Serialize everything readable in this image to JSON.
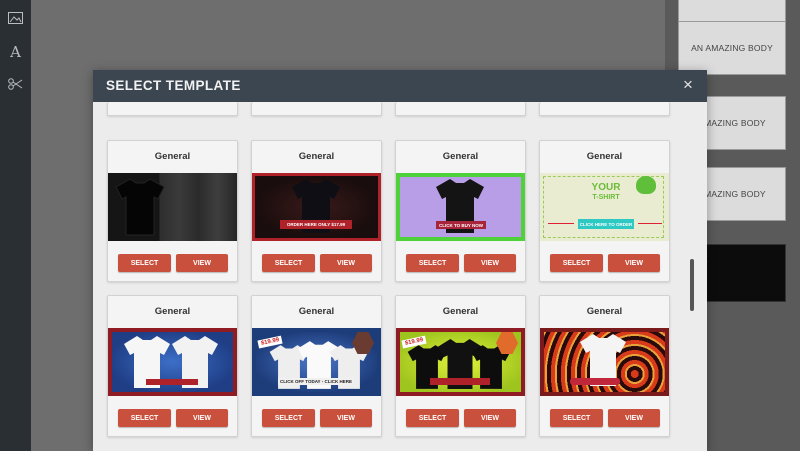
{
  "toolbar": {
    "items": [
      {
        "name": "image-icon"
      },
      {
        "name": "text-icon",
        "glyph": "A"
      },
      {
        "name": "scissors-icon"
      }
    ]
  },
  "side_panel": {
    "buttons": [
      "AN AMAZING BODY",
      "AMAZING BODY",
      "AMAZING BODY"
    ]
  },
  "modal": {
    "title": "SELECT TEMPLATE",
    "close_label": "×",
    "templates": [
      {
        "title": "General",
        "select_label": "SELECT",
        "view_label": "VIEW"
      },
      {
        "title": "General",
        "select_label": "SELECT",
        "view_label": "VIEW",
        "banner": "ORDER HERE ONLY $17.99"
      },
      {
        "title": "General",
        "select_label": "SELECT",
        "view_label": "VIEW",
        "banner": "CLICK TO BUY NOW"
      },
      {
        "title": "General",
        "select_label": "SELECT",
        "view_label": "VIEW",
        "headline_1": "YOUR",
        "headline_2": "T-SHIRT",
        "banner": "CLICK HERE TO ORDER"
      },
      {
        "title": "General",
        "select_label": "SELECT",
        "view_label": "VIEW"
      },
      {
        "title": "General",
        "select_label": "SELECT",
        "view_label": "VIEW",
        "price": "$19.99",
        "banner": "CLICK OFF TODAY - CLICK HERE"
      },
      {
        "title": "General",
        "select_label": "SELECT",
        "view_label": "VIEW",
        "price": "$19.99"
      },
      {
        "title": "General",
        "select_label": "SELECT",
        "view_label": "VIEW"
      }
    ]
  },
  "colors": {
    "header": "#3b4650",
    "button": "#c9503c",
    "accent_green": "#3fb44a"
  }
}
